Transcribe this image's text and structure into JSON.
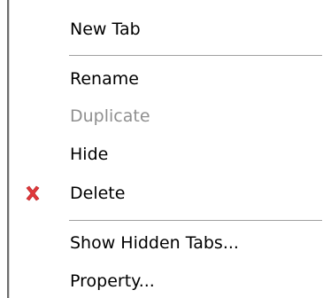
{
  "menu": {
    "items": [
      {
        "label": "New Tab",
        "enabled": true
      },
      {
        "label": "Rename",
        "enabled": true
      },
      {
        "label": "Duplicate",
        "enabled": false
      },
      {
        "label": "Hide",
        "enabled": true
      },
      {
        "label": "Delete",
        "enabled": true,
        "icon": "delete-x-icon"
      },
      {
        "label": "Show Hidden Tabs...",
        "enabled": true
      },
      {
        "label": "Property...",
        "enabled": true
      }
    ]
  },
  "colors": {
    "delete_icon": "#e0373a",
    "disabled_text": "#8f8f8f",
    "separator": "#a0a0a0"
  }
}
